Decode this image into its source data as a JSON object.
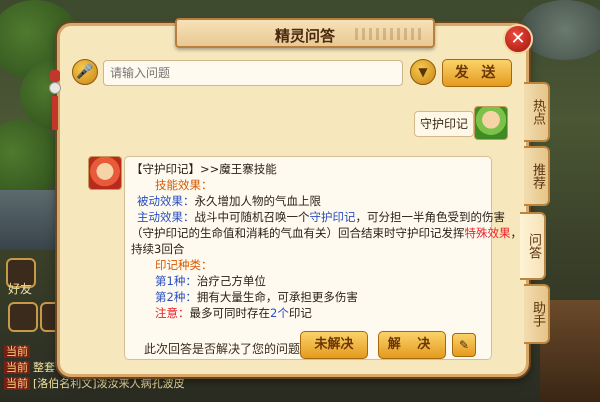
{
  "dialog": {
    "title": "精灵问答",
    "close_glyph": "✕"
  },
  "input": {
    "placeholder": "请输入问题",
    "send_label": "发 送"
  },
  "tabs": [
    {
      "label": "热点"
    },
    {
      "label": "推荐"
    },
    {
      "label": "问答"
    },
    {
      "label": "助手"
    }
  ],
  "chat": {
    "user_question": "守护印记",
    "answer": {
      "heading": "【守护印记】>>魔王寨技能",
      "skill_effect_label": "技能效果：",
      "passive_label": "被动效果：",
      "passive_text": "永久增加人物的气血上限",
      "active_label": "主动效果：",
      "active_text_1": "战斗中可随机召唤一个",
      "active_link": "守护印记",
      "active_text_2": "，可分担一半角色受到的伤害",
      "active_line2_1": "（守护印记的生命值和消耗的气血有关）回合结束时守护印记发挥",
      "active_line2_special": "特殊效果",
      "active_line2_2": "，",
      "active_line3": "持续3回合",
      "mark_types_label": "印记种类：",
      "type1_label": "第1种：",
      "type1_text": "治疗己方单位",
      "type2_label": "第2种：",
      "type2_text": "拥有大量生命，可承担更多伤害",
      "note_label": "注意：",
      "note_text_1": "最多可同时存在",
      "note_count": "2个",
      "note_text_2": "印记"
    },
    "feedback_question": "此次回答是否解决了您的问题?",
    "unresolved_label": "未解决",
    "resolved_label": "解 决"
  },
  "background_hud": {
    "side_label_1": "好友",
    "chat_tag_1": "当前",
    "chat_tag_2": "当前",
    "chat_tag_3": "当前",
    "chat_text_1": "整套",
    "chat_text_2": "[洛伯名利文]泼汝来人病孔波皮"
  }
}
